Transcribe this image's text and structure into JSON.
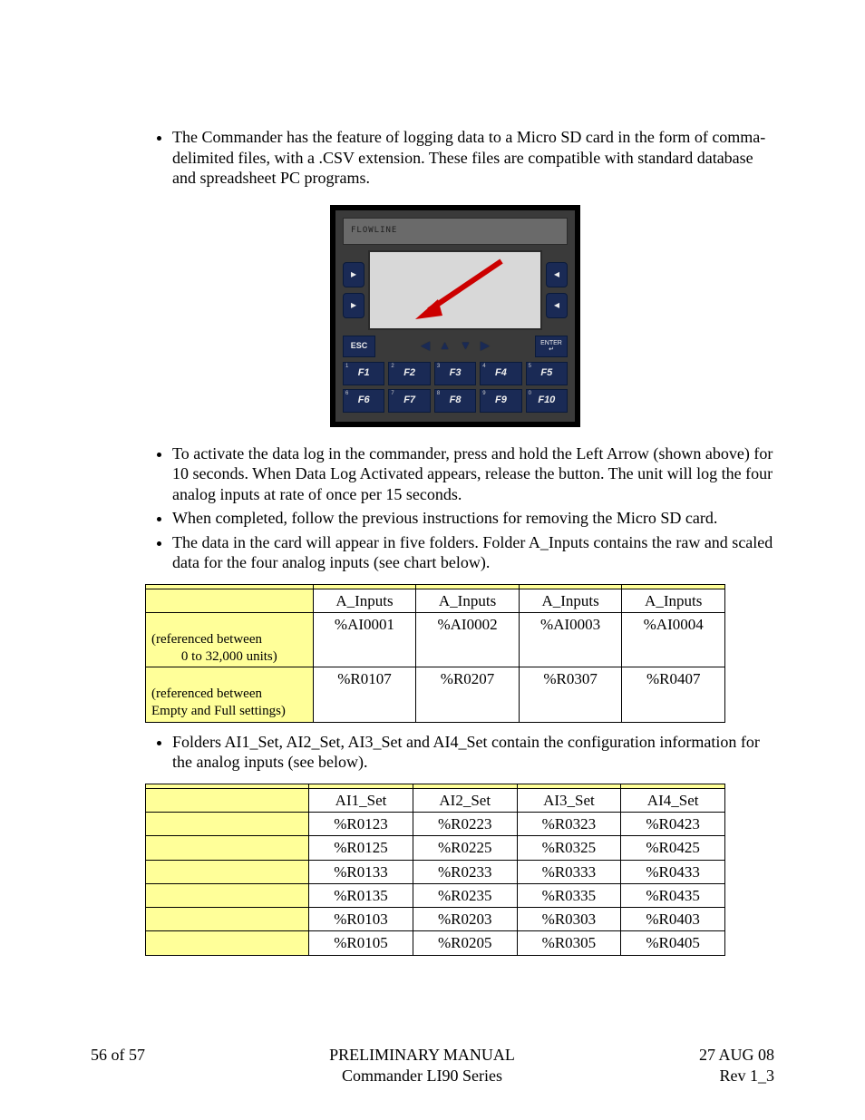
{
  "para1": "The Commander has the feature of logging data to a Micro SD card in the form of comma-delimited files, with a .CSV extension.  These files are compatible with standard database and spreadsheet PC programs.",
  "para2": "To activate the data log in the commander, press and hold the Left Arrow (shown above) for 10 seconds.  When Data Log Activated appears, release the button.  The unit will log the four analog inputs at rate of once per 15 seconds.",
  "para3": "When completed, follow the previous instructions for removing the Micro SD card.",
  "para4": "The data in the card will appear in five folders.  Folder A_Inputs contains the raw and scaled data for the four analog inputs (see chart below).",
  "para5": "Folders AI1_Set, AI2_Set, AI3_Set and AI4_Set contain the configuration information for the analog inputs (see below).",
  "device": {
    "banner": "FLOWLINE",
    "esc": "ESC",
    "enter": "ENTER",
    "fkeys1": [
      "F1",
      "F2",
      "F3",
      "F4",
      "F5"
    ],
    "fkeys2": [
      "F6",
      "F7",
      "F8",
      "F9",
      "F10"
    ]
  },
  "table1": {
    "r0": {
      "c0": "",
      "c1": "",
      "c2": "",
      "c3": "",
      "c4": ""
    },
    "r1": {
      "c0": "",
      "c1": "A_Inputs",
      "c2": "A_Inputs",
      "c3": "A_Inputs",
      "c4": "A_Inputs"
    },
    "r2": {
      "c0_l1": "(referenced between",
      "c0_l2": "0 to 32,000 units)",
      "c1": "%AI0001",
      "c2": "%AI0002",
      "c3": "%AI0003",
      "c4": "%AI0004"
    },
    "r3": {
      "c0_l1": "(referenced between",
      "c0_l2": "Empty and Full settings)",
      "c1": "%R0107",
      "c2": "%R0207",
      "c3": "%R0307",
      "c4": "%R0407"
    }
  },
  "table2": {
    "r0": {
      "c0": "",
      "c1": "",
      "c2": "",
      "c3": "",
      "c4": ""
    },
    "r1": {
      "c0": "",
      "c1": "AI1_Set",
      "c2": "AI2_Set",
      "c3": "AI3_Set",
      "c4": "AI4_Set"
    },
    "r2": {
      "c0": "",
      "c1": "%R0123",
      "c2": "%R0223",
      "c3": "%R0323",
      "c4": "%R0423"
    },
    "r3": {
      "c0": "",
      "c1": "%R0125",
      "c2": "%R0225",
      "c3": "%R0325",
      "c4": "%R0425"
    },
    "r4": {
      "c0": "",
      "c1": "%R0133",
      "c2": "%R0233",
      "c3": "%R0333",
      "c4": "%R0433"
    },
    "r5": {
      "c0": "",
      "c1": "%R0135",
      "c2": "%R0235",
      "c3": "%R0335",
      "c4": "%R0435"
    },
    "r6": {
      "c0": "",
      "c1": "%R0103",
      "c2": "%R0203",
      "c3": "%R0303",
      "c4": "%R0403"
    },
    "r7": {
      "c0": "",
      "c1": "%R0105",
      "c2": "%R0205",
      "c3": "%R0305",
      "c4": "%R0405"
    }
  },
  "footer": {
    "left": "56 of 57",
    "center_l1": "PRELIMINARY MANUAL",
    "center_l2": "Commander LI90 Series",
    "right_l1": "27 AUG 08",
    "right_l2": "Rev 1_3"
  }
}
